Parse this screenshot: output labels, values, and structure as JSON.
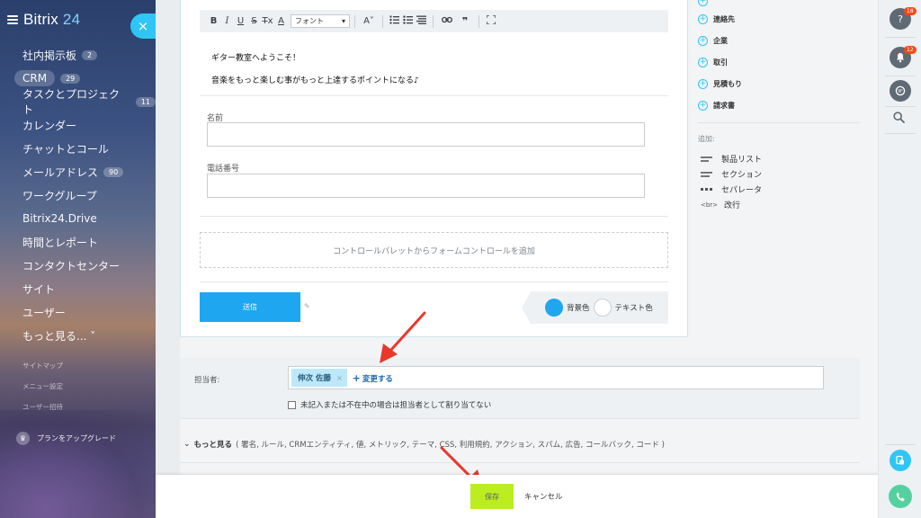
{
  "sidebar": {
    "logo_prefix": "Bitrix",
    "logo_number": "24",
    "collapse_icon": "×",
    "items": [
      {
        "label": "社内掲示板",
        "badge": "2"
      },
      {
        "label": "CRM",
        "badge": "29"
      },
      {
        "label": "タスクとプロジェクト",
        "badge": "11"
      },
      {
        "label": "カレンダー",
        "badge": ""
      },
      {
        "label": "チャットとコール",
        "badge": ""
      },
      {
        "label": "メールアドレス",
        "badge": "90"
      },
      {
        "label": "ワークグループ",
        "badge": ""
      },
      {
        "label": "Bitrix24.Drive",
        "badge": ""
      },
      {
        "label": "時間とレポート",
        "badge": ""
      },
      {
        "label": "コンタクトセンター",
        "badge": ""
      },
      {
        "label": "サイト",
        "badge": ""
      },
      {
        "label": "ユーザー",
        "badge": ""
      },
      {
        "label": "もっと見る... ˅",
        "badge": ""
      }
    ],
    "small_links": [
      "サイトマップ",
      "メニュー設定",
      "ユーザー招待"
    ],
    "upgrade_label": "プランをアップグレード"
  },
  "editor": {
    "toolbar": {
      "bold": "B",
      "italic": "I",
      "underline": "U",
      "strike": "S",
      "clear": "T̶x",
      "font_color": "A",
      "font_select": "フォント",
      "font_size": "A˅"
    },
    "lines": [
      "ギター教室へようこそ！",
      "音楽をもっと楽しむ事がもっと上達するポイントになる♪"
    ],
    "fields": [
      {
        "label": "名前",
        "value": ""
      },
      {
        "label": "電話番号",
        "value": ""
      }
    ],
    "add_control_hint": "コントロールパレットからフォームコントロールを追加",
    "submit_label": "送信",
    "bg_color_label": "背景色",
    "text_color_label": "テキスト色"
  },
  "palette": {
    "items": [
      "連絡先",
      "企業",
      "取引",
      "見積もり",
      "請求書"
    ],
    "add_heading": "追加:",
    "add_items": [
      {
        "label": "製品リスト"
      },
      {
        "label": "セクション"
      },
      {
        "label": "セパレータ"
      },
      {
        "label": "改行",
        "icon_text": "<br>"
      }
    ]
  },
  "responsible": {
    "label": "担当者:",
    "assignee": "伸次 佐藤",
    "chip_remove": "×",
    "change_label": "変更する",
    "checkbox_label": "未記入または不在中の場合は担当者として割り当てない"
  },
  "more": {
    "title": "もっと見る",
    "details": "( 署名, ルール, CRMエンティティ, 値, メトリック, テーマ, CSS, 利用規約, アクション, スパム, 広告, コールバック, コード  )"
  },
  "actions": {
    "save_label": "保存",
    "cancel_label": "キャンセル"
  },
  "right_bar": {
    "help_count": "18",
    "notifications_count": "12"
  },
  "colors": {
    "accent": "#2fc6f6",
    "submit": "#1ea7f0",
    "save": "#bbed21",
    "arrow": "#e8372b",
    "badge": "#f54819"
  }
}
